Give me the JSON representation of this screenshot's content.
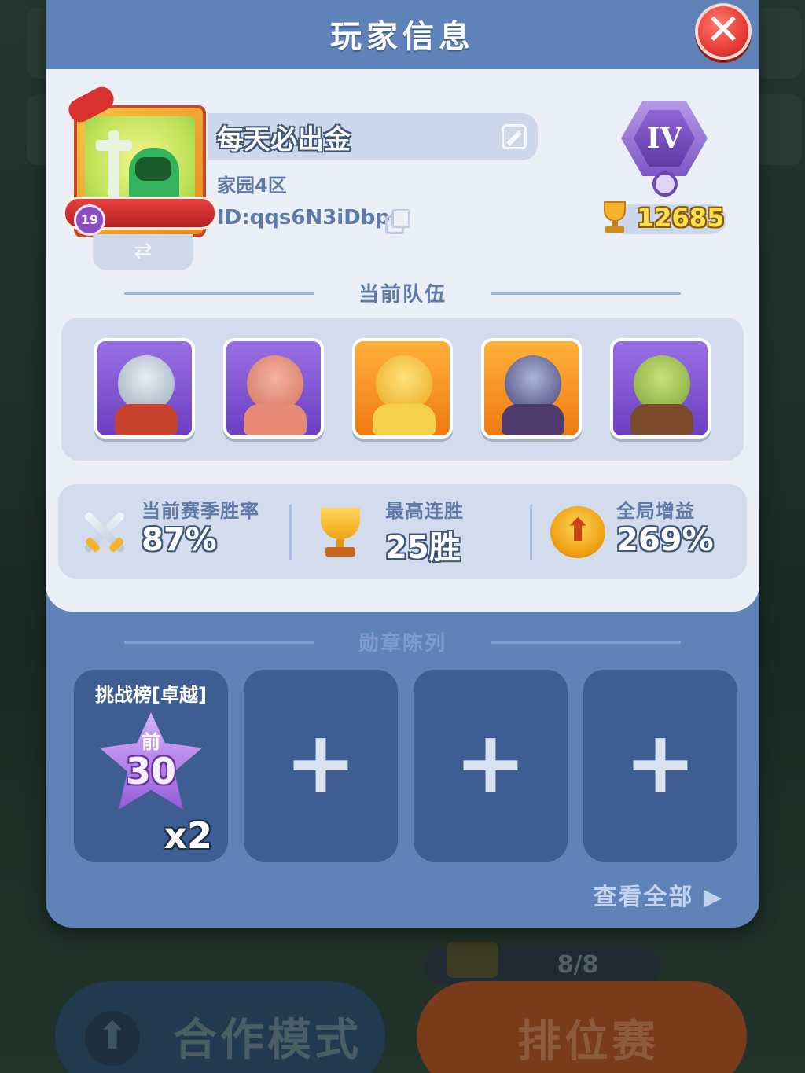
{
  "panel": {
    "title": "玩家信息",
    "close_symbol": "✕"
  },
  "player": {
    "name": "每天必出金",
    "server": "家园4区",
    "id": "ID:qqs6N3iDbp",
    "level": "19",
    "rank_label": "IV",
    "trophies": "12685",
    "swap_symbol": "⇄"
  },
  "team": {
    "heading": "当前队伍",
    "heroes": [
      {
        "name": "knight-hero",
        "frame": "purple"
      },
      {
        "name": "orc-warrior-hero",
        "frame": "purple"
      },
      {
        "name": "golden-winged-hero",
        "frame": "orange"
      },
      {
        "name": "dark-mage-hero",
        "frame": "orange"
      },
      {
        "name": "goblin-engineer-hero",
        "frame": "purple"
      }
    ]
  },
  "stats": {
    "season_winrate": {
      "label": "当前赛季胜率",
      "value": "87%",
      "icon": "crossed-swords-icon"
    },
    "max_streak": {
      "label": "最高连胜",
      "value": "25胜",
      "icon": "trophy-icon"
    },
    "global_bonus": {
      "label": "全局增益",
      "value": "269%",
      "icon": "upgrade-arrow-icon"
    }
  },
  "medals": {
    "heading": "勋章陈列",
    "first": {
      "title": "挑战榜[卓越]",
      "badge_top": "前",
      "badge_num": "30",
      "count": "x2"
    },
    "empty_symbol": "+",
    "view_all": "查看全部"
  },
  "background": {
    "coop_mode": "合作模式",
    "ranked": "排位赛",
    "counter": "8/8"
  },
  "colors": {
    "panel": "#5f82b9",
    "card": "#eaeff8",
    "slot": "#3e5e93",
    "close": "#e73c36"
  }
}
